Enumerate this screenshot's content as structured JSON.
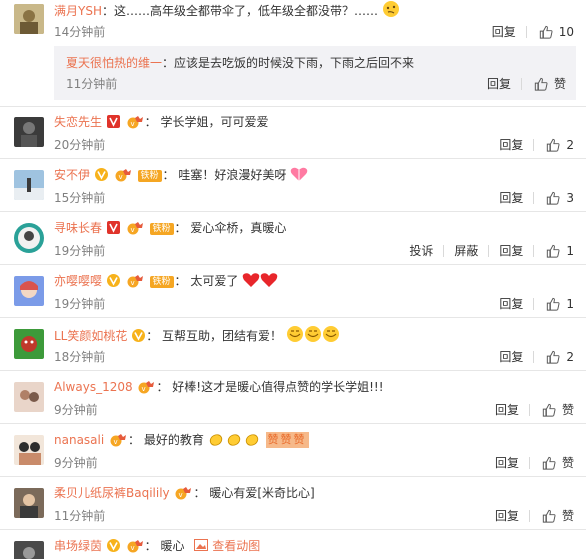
{
  "colors": {
    "username": "#eb7350",
    "time": "#808080",
    "reply_bg": "#f2f2f5"
  },
  "actions": {
    "reply": "回复",
    "report": "投诉",
    "block": "屏蔽",
    "like_zero": "赞"
  },
  "comments": [
    {
      "user": "满月YSH",
      "sep": "：",
      "text": "这……高年级全都带伞了，低年级全都没带？……",
      "time": "14分钟前",
      "likes": "10",
      "reply": {
        "user": "夏天很怕热的维一",
        "sep": "：",
        "text": "应该是去吃饭的时候没下雨，下雨之后回不来",
        "time": "11分钟前",
        "likes": "赞"
      }
    },
    {
      "user": "失恋先生",
      "sep": "：",
      "text": "学长学姐，可可爱爱",
      "time": "20分钟前",
      "likes": "2"
    },
    {
      "user": "安不伊",
      "fans_label": "铁粉",
      "sep": "：",
      "text": "哇塞！好浪漫好美呀",
      "time": "15分钟前",
      "likes": "3"
    },
    {
      "user": "寻味长春",
      "fans_label": "铁粉",
      "sep": "：",
      "text": "爱心伞桥，真暖心",
      "time": "19分钟前",
      "likes": "1"
    },
    {
      "user": "亦嘤嘤嘤",
      "fans_label": "铁粉",
      "sep": "：",
      "text": "太可爱了",
      "time": "19分钟前",
      "likes": "1"
    },
    {
      "user": "LL笑颜如桃花",
      "sep": "：",
      "text": "互帮互助，团结有爱！",
      "time": "18分钟前",
      "likes": "2"
    },
    {
      "user": "Always_1208",
      "sep": "：",
      "text": "好棒!这才是暖心值得点赞的学长学姐!!!",
      "time": "9分钟前",
      "likes": "赞"
    },
    {
      "user": "nanasali",
      "sep": "：",
      "text": "最好的教育",
      "time": "9分钟前",
      "likes": "赞",
      "stamp_text": "赞赞赞"
    },
    {
      "user": "柔贝儿纸尿裤Baqilily",
      "sep": "：",
      "text": "暖心有爱[米奇比心]",
      "time": "11分钟前",
      "likes": "赞"
    },
    {
      "user": "串场绿茵",
      "sep": "：",
      "text": "暖心",
      "link": "查看动图"
    }
  ]
}
